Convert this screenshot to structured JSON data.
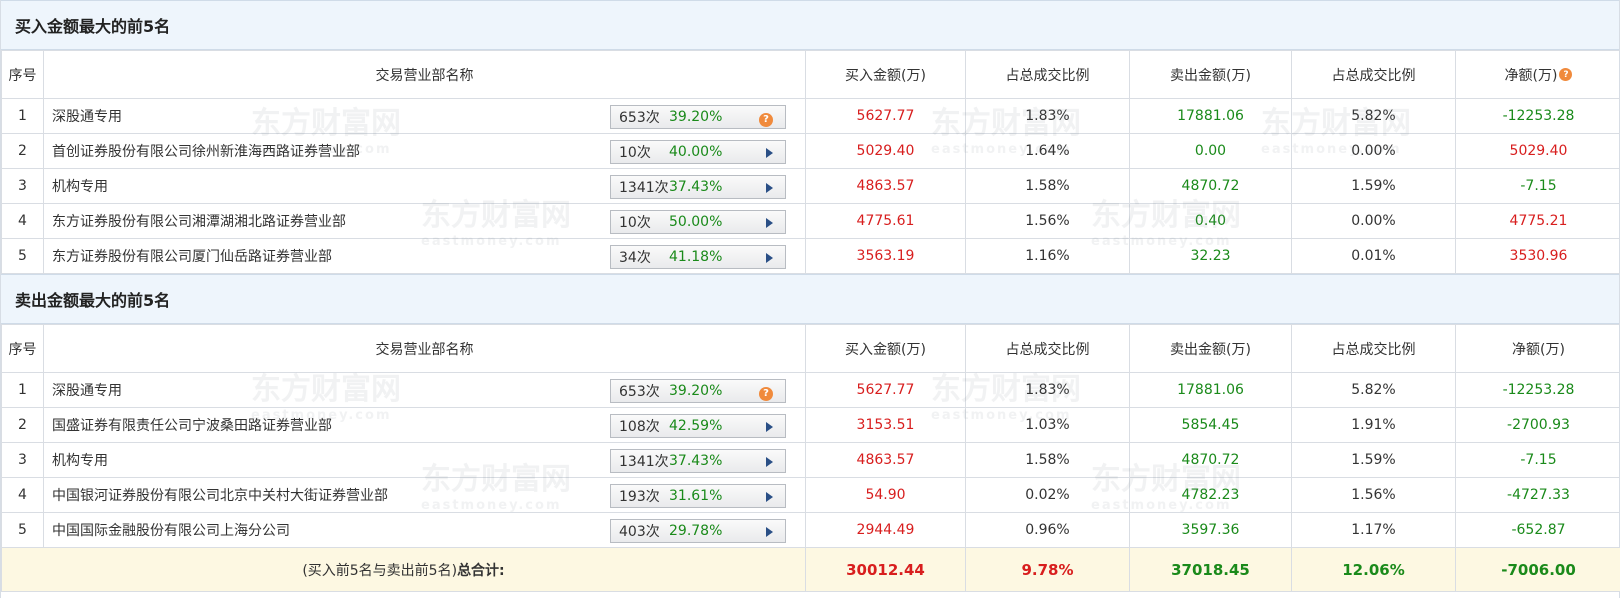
{
  "buy_section": {
    "title": "买入金额最大的前5名",
    "headers": [
      "序号",
      "交易营业部名称",
      "买入金额(万)",
      "占总成交比例",
      "卖出金额(万)",
      "占总成交比例",
      "净额(万)"
    ],
    "rows": [
      {
        "idx": "1",
        "name": "深股通专用",
        "count": "653次",
        "pct": "39.20%",
        "icon": "question-icon",
        "buy": "5627.77",
        "buy_pct": "1.83%",
        "sell": "17881.06",
        "sell_pct": "5.82%",
        "net": "-12253.28",
        "net_color": "green"
      },
      {
        "idx": "2",
        "name": "首创证券股份有限公司徐州新淮海西路证券营业部",
        "count": "10次",
        "pct": "40.00%",
        "icon": "arrow-right-icon",
        "buy": "5029.40",
        "buy_pct": "1.64%",
        "sell": "0.00",
        "sell_pct": "0.00%",
        "net": "5029.40",
        "net_color": "red"
      },
      {
        "idx": "3",
        "name": "机构专用",
        "count": "1341次",
        "pct": "37.43%",
        "icon": "arrow-right-icon",
        "buy": "4863.57",
        "buy_pct": "1.58%",
        "sell": "4870.72",
        "sell_pct": "1.59%",
        "net": "-7.15",
        "net_color": "green"
      },
      {
        "idx": "4",
        "name": "东方证券股份有限公司湘潭湖湘北路证券营业部",
        "count": "10次",
        "pct": "50.00%",
        "icon": "arrow-right-icon",
        "buy": "4775.61",
        "buy_pct": "1.56%",
        "sell": "0.40",
        "sell_pct": "0.00%",
        "net": "4775.21",
        "net_color": "red"
      },
      {
        "idx": "5",
        "name": "东方证券股份有限公司厦门仙岳路证券营业部",
        "count": "34次",
        "pct": "41.18%",
        "icon": "arrow-right-icon",
        "buy": "3563.19",
        "buy_pct": "1.16%",
        "sell": "32.23",
        "sell_pct": "0.01%",
        "net": "3530.96",
        "net_color": "red"
      }
    ]
  },
  "sell_section": {
    "title": "卖出金额最大的前5名",
    "headers": [
      "序号",
      "交易营业部名称",
      "买入金额(万)",
      "占总成交比例",
      "卖出金额(万)",
      "占总成交比例",
      "净额(万)"
    ],
    "rows": [
      {
        "idx": "1",
        "name": "深股通专用",
        "count": "653次",
        "pct": "39.20%",
        "icon": "question-icon",
        "buy": "5627.77",
        "buy_pct": "1.83%",
        "sell": "17881.06",
        "sell_pct": "5.82%",
        "net": "-12253.28",
        "net_color": "green"
      },
      {
        "idx": "2",
        "name": "国盛证券有限责任公司宁波桑田路证券营业部",
        "count": "108次",
        "pct": "42.59%",
        "icon": "arrow-right-icon",
        "buy": "3153.51",
        "buy_pct": "1.03%",
        "sell": "5854.45",
        "sell_pct": "1.91%",
        "net": "-2700.93",
        "net_color": "green"
      },
      {
        "idx": "3",
        "name": "机构专用",
        "count": "1341次",
        "pct": "37.43%",
        "icon": "arrow-right-icon",
        "buy": "4863.57",
        "buy_pct": "1.58%",
        "sell": "4870.72",
        "sell_pct": "1.59%",
        "net": "-7.15",
        "net_color": "green"
      },
      {
        "idx": "4",
        "name": "中国银河证券股份有限公司北京中关村大街证券营业部",
        "count": "193次",
        "pct": "31.61%",
        "icon": "arrow-right-icon",
        "buy": "54.90",
        "buy_pct": "0.02%",
        "sell": "4782.23",
        "sell_pct": "1.56%",
        "net": "-4727.33",
        "net_color": "green"
      },
      {
        "idx": "5",
        "name": "中国国际金融股份有限公司上海分公司",
        "count": "403次",
        "pct": "29.78%",
        "icon": "arrow-right-icon",
        "buy": "2944.49",
        "buy_pct": "0.96%",
        "sell": "3597.36",
        "sell_pct": "1.17%",
        "net": "-652.87",
        "net_color": "green"
      }
    ]
  },
  "total": {
    "label_prefix": "(买入前5名与卖出前5名)",
    "label_bold": "总合计:",
    "buy": "30012.44",
    "buy_pct": "9.78%",
    "sell": "37018.45",
    "sell_pct": "12.06%",
    "net": "-7006.00"
  },
  "watermark": {
    "cn": "东方财富网",
    "en": "eastmoney.com"
  },
  "colors": {
    "red": "#d81e1e",
    "green": "#1a8a1a",
    "header_bg": "#eef5fc",
    "total_bg": "#fdf8e2",
    "icon_orange": "#f08a3c",
    "arrow_blue": "#2a4f86"
  }
}
